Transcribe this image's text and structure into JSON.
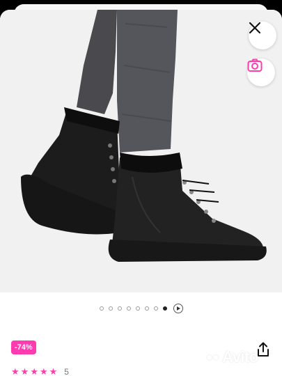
{
  "gallery": {
    "image_alt": "black leather high-top sneakers with fur trim",
    "total_slides": 8,
    "active_slide": 8,
    "has_video": true
  },
  "product": {
    "discount": "-74%",
    "rating_stars": 5,
    "reviews_count": "5"
  },
  "watermark": {
    "text": "Avito"
  },
  "colors": {
    "accent": "#ff3bb0",
    "photo_bg": "#f1f1f1"
  },
  "icons": {
    "close": "close-icon",
    "camera": "camera-icon",
    "share": "share-icon",
    "play": "play-icon",
    "star": "star-icon"
  }
}
